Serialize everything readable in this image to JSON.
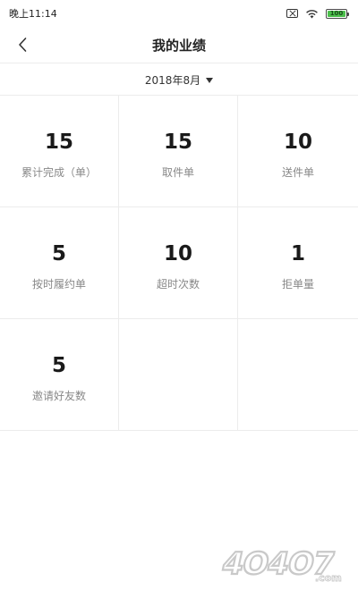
{
  "status_bar": {
    "time": "晚上11:14",
    "icons": [
      "sim-card-x-icon",
      "wifi-icon",
      "battery-icon"
    ],
    "battery_level": "100"
  },
  "header": {
    "title": "我的业绩",
    "back_icon": "chevron-left-icon"
  },
  "month_selector": {
    "value": "2018年8月",
    "icon": "caret-down-icon"
  },
  "stats": [
    {
      "value": "15",
      "label": "累计完成（单）"
    },
    {
      "value": "15",
      "label": "取件单"
    },
    {
      "value": "10",
      "label": "送件单"
    },
    {
      "value": "5",
      "label": "按时履约单"
    },
    {
      "value": "10",
      "label": "超时次数"
    },
    {
      "value": "1",
      "label": "拒单量"
    },
    {
      "value": "5",
      "label": "邀请好友数"
    },
    {
      "value": "",
      "label": ""
    },
    {
      "value": "",
      "label": ""
    }
  ],
  "watermark": {
    "text": "4O4O7",
    "suffix": ".com"
  },
  "colors": {
    "text_primary": "#1a1a1a",
    "text_secondary": "#888888",
    "divider": "#ececec",
    "battery": "#4cbf4c"
  }
}
